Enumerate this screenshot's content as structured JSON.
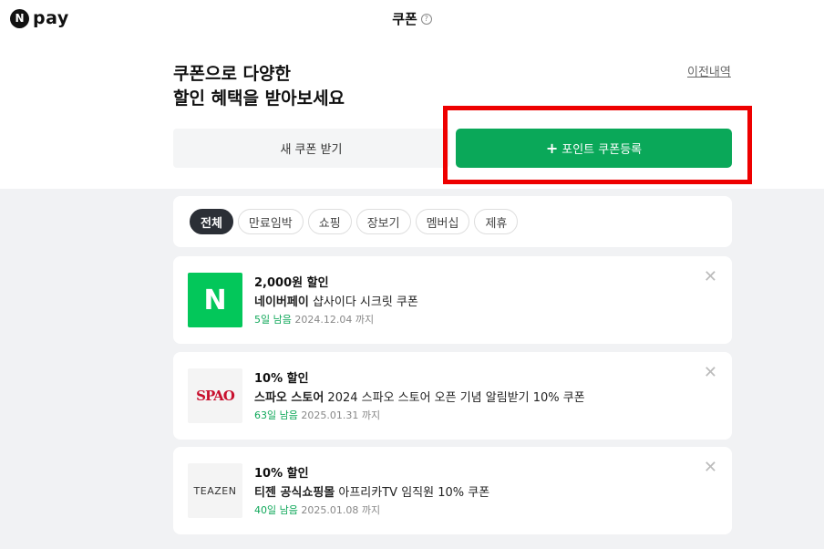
{
  "app": {
    "logo_badge": "N",
    "logo_text": "pay"
  },
  "header": {
    "title": "쿠폰",
    "help_glyph": "?"
  },
  "hero": {
    "line1": "쿠폰으로 다양한",
    "line2": "할인 혜택을 받아보세요",
    "history_link": "이전내역"
  },
  "actions": {
    "new_coupon_label": "새 쿠폰 받기",
    "register_plus": "+",
    "register_label": "포인트 쿠폰등록"
  },
  "filters": [
    {
      "label": "전체",
      "active": true
    },
    {
      "label": "만료임박",
      "active": false
    },
    {
      "label": "쇼핑",
      "active": false
    },
    {
      "label": "장보기",
      "active": false
    },
    {
      "label": "멤버십",
      "active": false
    },
    {
      "label": "제휴",
      "active": false
    }
  ],
  "coupons": [
    {
      "logo_text": "N",
      "amount": "2,000원 할인",
      "store": "네이버페이",
      "name": " 샵사이다 시크릿 쿠폰",
      "days_left": "5일 남음",
      "expiry": " 2024.12.04 까지"
    },
    {
      "logo_text": "SPAO",
      "amount": "10% 할인",
      "store": "스파오 스토어",
      "name": " 2024 스파오 스토어 오픈 기념 알림받기 10% 쿠폰",
      "days_left": "63일 남음",
      "expiry": " 2025.01.31 까지"
    },
    {
      "logo_text": "TEAZEN",
      "amount": "10% 할인",
      "store": "티젠 공식쇼핑몰",
      "name": " 아프리카TV 임직원 10% 쿠폰",
      "days_left": "40일 남음",
      "expiry": " 2025.01.08 까지"
    }
  ],
  "icons": {
    "close": "close-icon",
    "help": "help-icon",
    "plus": "plus-icon"
  },
  "colors": {
    "brand_green": "#0aa859",
    "active_chip": "#2b2f36",
    "days_left": "#10a85a",
    "highlight": "#ee0000"
  }
}
